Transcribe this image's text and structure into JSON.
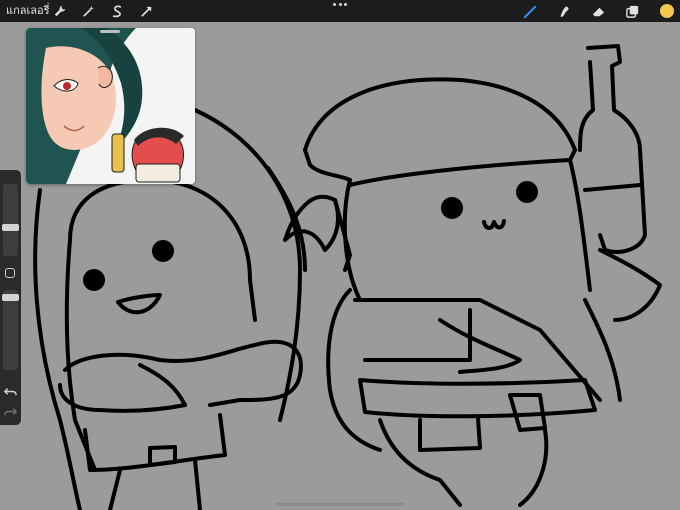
{
  "app": {
    "gallery_label": "แกลเลอรี่",
    "current_color": "#f2c94c",
    "accent": "#3d8bff",
    "canvas_color": "#9b9b9b"
  },
  "toolbar": {
    "left_tools": [
      "wrench-icon",
      "magic-wand-icon",
      "selection-icon",
      "transform-icon"
    ],
    "right_tools": [
      "brush-icon",
      "smudge-icon",
      "eraser-icon",
      "layers-icon"
    ],
    "active_tool": "brush-icon",
    "more_menu": "more-dots-icon"
  },
  "sidebar": {
    "brush_size_level": 0.45,
    "opacity_level": 0.25,
    "undo_icon": "undo-icon",
    "redo_icon": "redo-icon"
  },
  "reference": {
    "content": "reference-image"
  }
}
